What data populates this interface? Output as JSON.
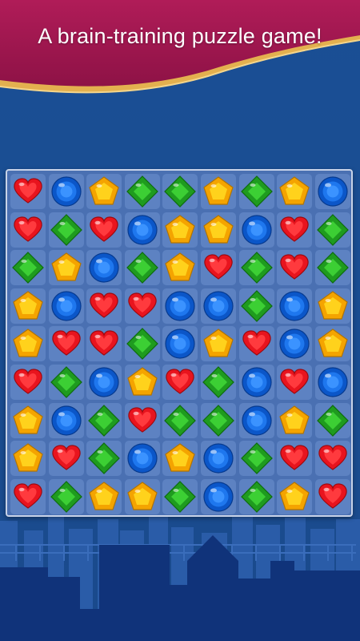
{
  "header": {
    "title": "A brain-training puzzle game!"
  },
  "colors": {
    "banner": "#a0174f",
    "gold_trim": "#e3b04f",
    "sky": "#1c4f92",
    "board": "#4a70b2",
    "cell": "#5d82c2",
    "skyline_back": "#2a5ca8",
    "skyline_front": "#10337a"
  },
  "gem_types": {
    "H": "red-heart-gem",
    "C": "blue-round-gem",
    "P": "yellow-pentagon-gem",
    "D": "green-diamond-gem"
  },
  "board": {
    "rows": 9,
    "cols": 9,
    "grid": [
      [
        "H",
        "C",
        "P",
        "D",
        "D",
        "P",
        "D",
        "P",
        "C"
      ],
      [
        "H",
        "D",
        "H",
        "C",
        "P",
        "P",
        "C",
        "H",
        "D"
      ],
      [
        "D",
        "P",
        "C",
        "D",
        "P",
        "H",
        "D",
        "H",
        "D"
      ],
      [
        "P",
        "C",
        "H",
        "H",
        "C",
        "C",
        "D",
        "C",
        "P"
      ],
      [
        "P",
        "H",
        "H",
        "D",
        "C",
        "P",
        "H",
        "C",
        "P"
      ],
      [
        "H",
        "D",
        "C",
        "P",
        "H",
        "D",
        "C",
        "H",
        "C"
      ],
      [
        "P",
        "C",
        "D",
        "H",
        "D",
        "D",
        "C",
        "P",
        "D"
      ],
      [
        "P",
        "H",
        "D",
        "C",
        "P",
        "C",
        "D",
        "H",
        "H"
      ],
      [
        "H",
        "D",
        "P",
        "P",
        "D",
        "C",
        "D",
        "P",
        "H"
      ]
    ]
  }
}
